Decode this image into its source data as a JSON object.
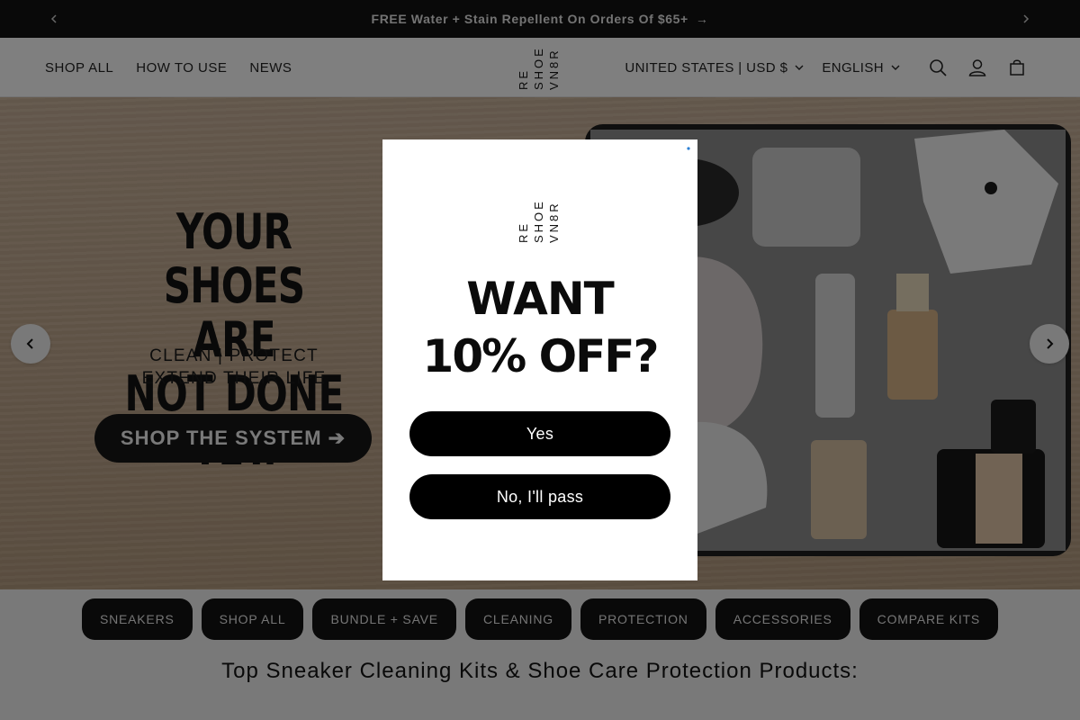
{
  "announcement": {
    "message": "FREE Water + Stain Repellent On Orders Of $65+",
    "arrow": "→",
    "prev_icon": "chevron-left-icon",
    "next_icon": "chevron-right-icon"
  },
  "header": {
    "nav": [
      {
        "label": "SHOP ALL"
      },
      {
        "label": "HOW TO USE"
      },
      {
        "label": "NEWS"
      }
    ],
    "logo_lines": [
      "RE",
      "SHOE",
      "VN8R"
    ],
    "country_selector": "UNITED STATES | USD $",
    "language_selector": "ENGLISH",
    "icons": [
      "search-icon",
      "account-icon",
      "cart-icon"
    ]
  },
  "hero": {
    "headline_line1": "YOUR SHOES ARE",
    "headline_line2": "NOT DONE YET.",
    "subline_line1": "CLEAN | PROTECT",
    "subline_line2": "EXTEND THEIR LIFE",
    "cta_label": "SHOP THE SYSTEM ➔",
    "prev_icon": "chevron-left-icon",
    "next_icon": "chevron-right-icon"
  },
  "categories": [
    {
      "label": "SNEAKERS"
    },
    {
      "label": "SHOP ALL"
    },
    {
      "label": "BUNDLE + SAVE"
    },
    {
      "label": "CLEANING"
    },
    {
      "label": "PROTECTION"
    },
    {
      "label": "ACCESSORIES"
    },
    {
      "label": "COMPARE KITS"
    }
  ],
  "section_title": "Top Sneaker Cleaning Kits & Shoe Care Protection Products:",
  "popup": {
    "logo_lines": [
      "RE",
      "SHOE",
      "VN8R"
    ],
    "offer_line1": "WANT",
    "offer_line2": "10% OFF?",
    "yes_label": "Yes",
    "no_label": "No, I'll pass",
    "close_icon": "close-icon"
  },
  "colors": {
    "announcement_bg": "#121212",
    "pill_bg": "#121212",
    "hero_bg": "#c4ab91",
    "modal_button": "#000000"
  }
}
